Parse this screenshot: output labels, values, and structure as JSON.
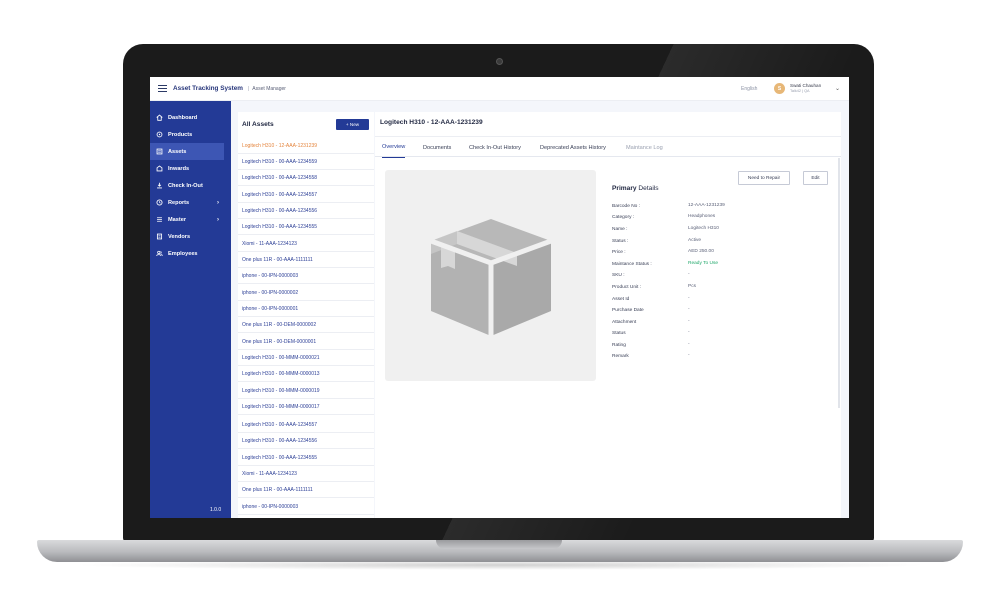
{
  "header": {
    "app_title": "Asset Tracking System",
    "separator": "|",
    "breadcrumb": "Asset Manager",
    "language": "English",
    "user_initial": "S",
    "user_name": "Swati Chauhan",
    "user_sub": "Talk42 | QA"
  },
  "sidebar": {
    "items": [
      {
        "label": "Dashboard",
        "icon": "home-icon",
        "active": false
      },
      {
        "label": "Products",
        "icon": "tag-icon",
        "active": false
      },
      {
        "label": "Assets",
        "icon": "list-icon",
        "active": true
      },
      {
        "label": "Inwards",
        "icon": "inbox-icon",
        "active": false
      },
      {
        "label": "Check In-Out",
        "icon": "swap-icon",
        "active": false
      },
      {
        "label": "Reports",
        "icon": "clock-icon",
        "active": false,
        "chevron": "›"
      },
      {
        "label": "Master",
        "icon": "menu-icon",
        "active": false,
        "chevron": "›"
      },
      {
        "label": "Vendors",
        "icon": "document-icon",
        "active": false
      },
      {
        "label": "Employees",
        "icon": "users-icon",
        "active": false
      }
    ],
    "version": "1.0.0"
  },
  "asset_list": {
    "title": "All Assets",
    "new_button": "+ New",
    "items": [
      "Logitech H310 - 12-AAA-1231239",
      "Logitech H310 - 00-AAA-1234559",
      "Logitech H310 - 00-AAA-1234558",
      "Logitech H310 - 00-AAA-1234557",
      "Logitech H310 - 00-AAA-1234556",
      "Logitech H310 - 00-AAA-1234555",
      "Xiomi - 11-AAA-1234123",
      "One plus 11R - 00-AAA-1111111",
      "iphone - 00-IPN-0000003",
      "iphone - 00-IPN-0000002",
      "iphone - 00-IPN-0000001",
      "One plus 11R - 00-DEM-0000002",
      "One plus 11R - 00-DEM-0000001",
      "Logitech H310 - 00-MMM-0000021",
      "Logitech H310 - 00-MMM-0000013",
      "Logitech H310 - 00-MMM-0000019",
      "Logitech H310 - 00-MMM-0000017",
      "Logitech H310 - 00-AAA-1234557",
      "Logitech H310 - 00-AAA-1234556",
      "Logitech H310 - 00-AAA-1234555",
      "Xiomi - 11-AAA-1234123",
      "One plus 11R - 00-AAA-1111111",
      "iphone - 00-IPN-0000003"
    ],
    "selected_index": 0
  },
  "detail": {
    "title": "Logitech H310 - 12-AAA-1231239",
    "tabs": [
      {
        "label": "Overview",
        "state": "active"
      },
      {
        "label": "Documents",
        "state": "normal"
      },
      {
        "label": "Check In-Out History",
        "state": "normal"
      },
      {
        "label": "Deprecated Assets History",
        "state": "normal"
      },
      {
        "label": "Maintance Log",
        "state": "disabled"
      }
    ],
    "need_repair_button": "Need to Repair",
    "edit_button": "Edit",
    "section_heading_bold": "Primary",
    "section_heading_rest": " Details",
    "fields": [
      {
        "label": "Barcode No :",
        "value": "12-AAA-1231239"
      },
      {
        "label": "Category :",
        "value": "Headphones"
      },
      {
        "label": "Name :",
        "value": "Logitech H310"
      },
      {
        "label": "Status :",
        "value": "Active"
      },
      {
        "label": "Price :",
        "value": "AED 250.00"
      },
      {
        "label": "Maintance Status :",
        "value": "Ready To Use",
        "color": "#21a86b"
      },
      {
        "label": "SKU :",
        "value": "-"
      },
      {
        "label": "Product Unit :",
        "value": "Pcs"
      },
      {
        "label": "Asset Id",
        "value": "-"
      },
      {
        "label": "Purchase Date",
        "value": "-"
      },
      {
        "label": "Attachment",
        "value": "-"
      },
      {
        "label": "Status",
        "value": "-"
      },
      {
        "label": "Rating",
        "value": "-"
      },
      {
        "label": "Remark",
        "value": "-"
      }
    ],
    "image_icon": "package-box-icon"
  },
  "colors": {
    "sidebar": "#233a96",
    "accent": "#233a96",
    "selected_item": "#e4843c",
    "ready": "#21a86b"
  }
}
